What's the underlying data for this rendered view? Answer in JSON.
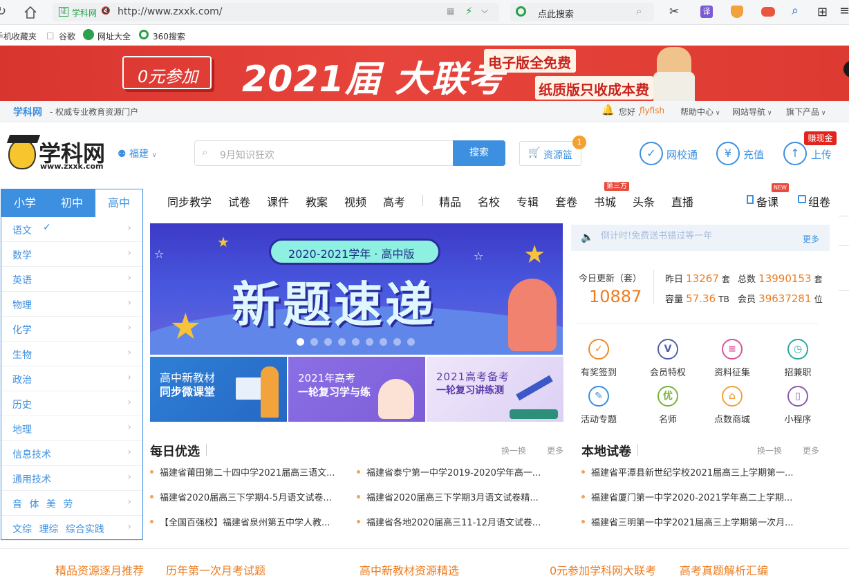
{
  "browser": {
    "site_badge": "学科网",
    "url": "http://www.zxxk.com/",
    "search_placeholder": "点此搜索",
    "translate_icon_label": "译"
  },
  "bookmarks": [
    "手机收藏夹",
    "谷歌",
    "网址大全",
    "360搜索"
  ],
  "banner": {
    "button": "0元参加",
    "headline": "2021届 大联考",
    "line1": "电子版全免费",
    "line2": "纸质版只收成本费"
  },
  "infobar": {
    "brand": "学科网",
    "slogan": "- 权威专业教育资源门户",
    "greeting": "您好 ,",
    "username": "flyfish",
    "links": [
      "帮助中心",
      "网站导航",
      "旗下产品"
    ]
  },
  "header": {
    "logo_text": "学科网",
    "logo_url": "www.zxxk.com",
    "region": "福建",
    "search_placeholder": "9月知识狂欢",
    "search_button": "搜索",
    "basket_label": "资源篮",
    "basket_count": "1",
    "actions": [
      "网校通",
      "充值",
      "上传"
    ],
    "cash_tag": "赚现金"
  },
  "sidebar": {
    "tabs": [
      "小学",
      "初中",
      "高中"
    ],
    "active_tab": "高中",
    "subjects": [
      "语文",
      "数学",
      "英语",
      "物理",
      "化学",
      "生物",
      "政治",
      "历史",
      "地理",
      "信息技术",
      "通用技术",
      "音 体 美 劳",
      "文综 理综 综合实践"
    ]
  },
  "nav": {
    "items": [
      "同步教学",
      "试卷",
      "课件",
      "教案",
      "视频",
      "高考",
      "精品",
      "名校",
      "专辑",
      "套卷",
      "书城",
      "头条",
      "直播"
    ],
    "third_party_tag": "第三方",
    "new_tag": "NEW",
    "right": [
      "备课",
      "组卷"
    ]
  },
  "carousel": {
    "pill": "2020-2021学年 · 高中版",
    "headline": "新题速递",
    "dot_count": 9
  },
  "thumbs": [
    {
      "line1": "高中新教材",
      "line2": "同步微课堂"
    },
    {
      "line1": "2021年高考",
      "line2": "一轮复习学与练"
    },
    {
      "line1": "2021高考备考",
      "line2": "一轮复习讲练测"
    }
  ],
  "notice": {
    "text": "倒计时!免费送书错过等一年",
    "more": "更多"
  },
  "stats": {
    "today_label": "今日更新（套）",
    "today_value": "10887",
    "yesterday_label": "昨日",
    "yesterday_value": "13267",
    "yesterday_unit": "套",
    "total_label": "总数",
    "total_value": "13990153",
    "total_unit": "套",
    "capacity_label": "容量",
    "capacity_value": "57.36",
    "capacity_unit": "TB",
    "members_label": "会员",
    "members_value": "39637281",
    "members_unit": "位"
  },
  "features": [
    {
      "label": "有奖签到",
      "icon": "calendar-check-icon",
      "color": "#f08a24"
    },
    {
      "label": "会员特权",
      "icon": "vip-icon",
      "color": "#5560a8"
    },
    {
      "label": "资料征集",
      "icon": "document-icon",
      "color": "#d9549a"
    },
    {
      "label": "招兼职",
      "icon": "clock-icon",
      "color": "#2fa8a0"
    },
    {
      "label": "活动专题",
      "icon": "edit-icon",
      "color": "#3a8fe0"
    },
    {
      "label": "名师",
      "icon": "teacher-icon",
      "color": "#79b33c"
    },
    {
      "label": "点数商城",
      "icon": "shop-icon",
      "color": "#f0a43c"
    },
    {
      "label": "小程序",
      "icon": "phone-icon",
      "color": "#8a5ab0"
    }
  ],
  "daily": {
    "title": "每日优选",
    "swap": "换一换",
    "more": "更多",
    "items": [
      "福建省莆田第二十四中学2021届高三语文...",
      "福建省泰宁第一中学2019-2020学年高一...",
      "福建省2020届高三下学期4-5月语文试卷...",
      "福建省2020届高三下学期3月语文试卷精...",
      "【全国百强校】福建省泉州第五中学人教...",
      "福建省各地2020届高三11-12月语文试卷..."
    ]
  },
  "local": {
    "title": "本地试卷",
    "swap": "换一换",
    "more": "更多",
    "items": [
      "福建省平潭县新世纪学校2021届高三上学期第一...",
      "福建省厦门第一中学2020-2021学年高二上学期...",
      "福建省三明第一中学2021届高三上学期第一次月..."
    ]
  },
  "bottom_links": [
    "精品资源逐月推荐",
    "历年第一次月考试题",
    "高中新教材资源精选",
    "0元参加学科网大联考",
    "高考真题解析汇编"
  ]
}
